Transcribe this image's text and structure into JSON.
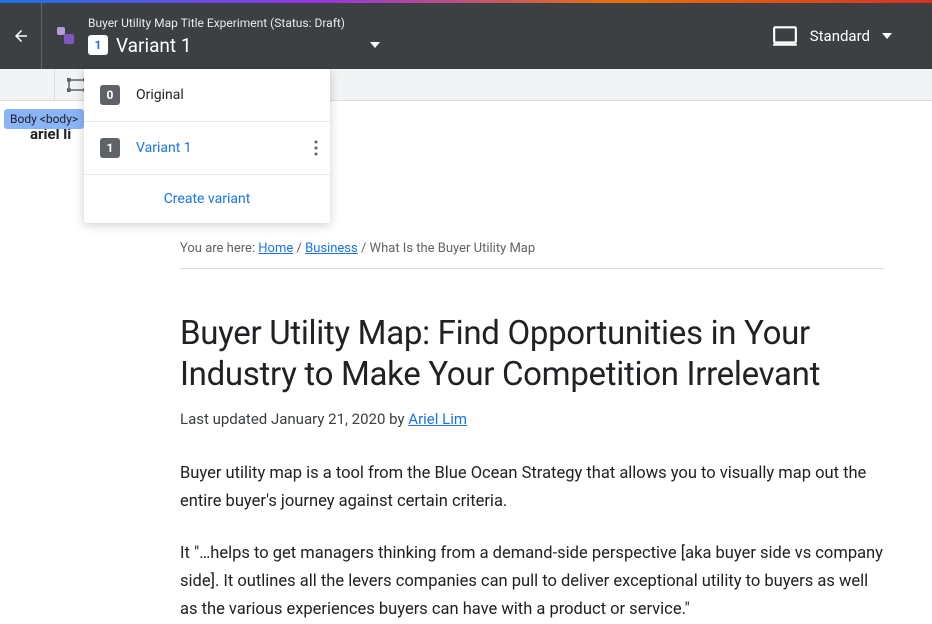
{
  "header": {
    "experiment_title": "Buyer Utility Map Title Experiment (Status: Draft)",
    "variant_badge": "1",
    "variant_name": "Variant 1",
    "device_label": "Standard"
  },
  "dropdown": {
    "items": [
      {
        "badge": "0",
        "label": "Original",
        "active": false
      },
      {
        "badge": "1",
        "label": "Variant 1",
        "active": true
      }
    ],
    "create_label": "Create variant"
  },
  "body_tag": "Body <body>",
  "preview_snippet": "ariel li",
  "page": {
    "breadcrumb_prefix": "You are here: ",
    "breadcrumb_home": "Home",
    "breadcrumb_sep": " / ",
    "breadcrumb_business": "Business",
    "breadcrumb_current": " / What Is the Buyer Utility Map",
    "title": "Buyer Utility Map: Find Opportunities in Your Industry to Make Your Competition Irrelevant",
    "meta_prefix": "Last updated January 21, 2020 by ",
    "meta_author": "Ariel Lim",
    "para1": "Buyer utility map is a tool from the Blue Ocean Strategy that allows you to visually map out the entire buyer's journey against certain criteria.",
    "para2": "It \"…helps to get managers thinking from a demand-side perspective [aka buyer side vs company side]. It outlines all the levers companies can pull to deliver exceptional utility to buyers as well as the various experiences buyers can have with a product or service.\""
  }
}
